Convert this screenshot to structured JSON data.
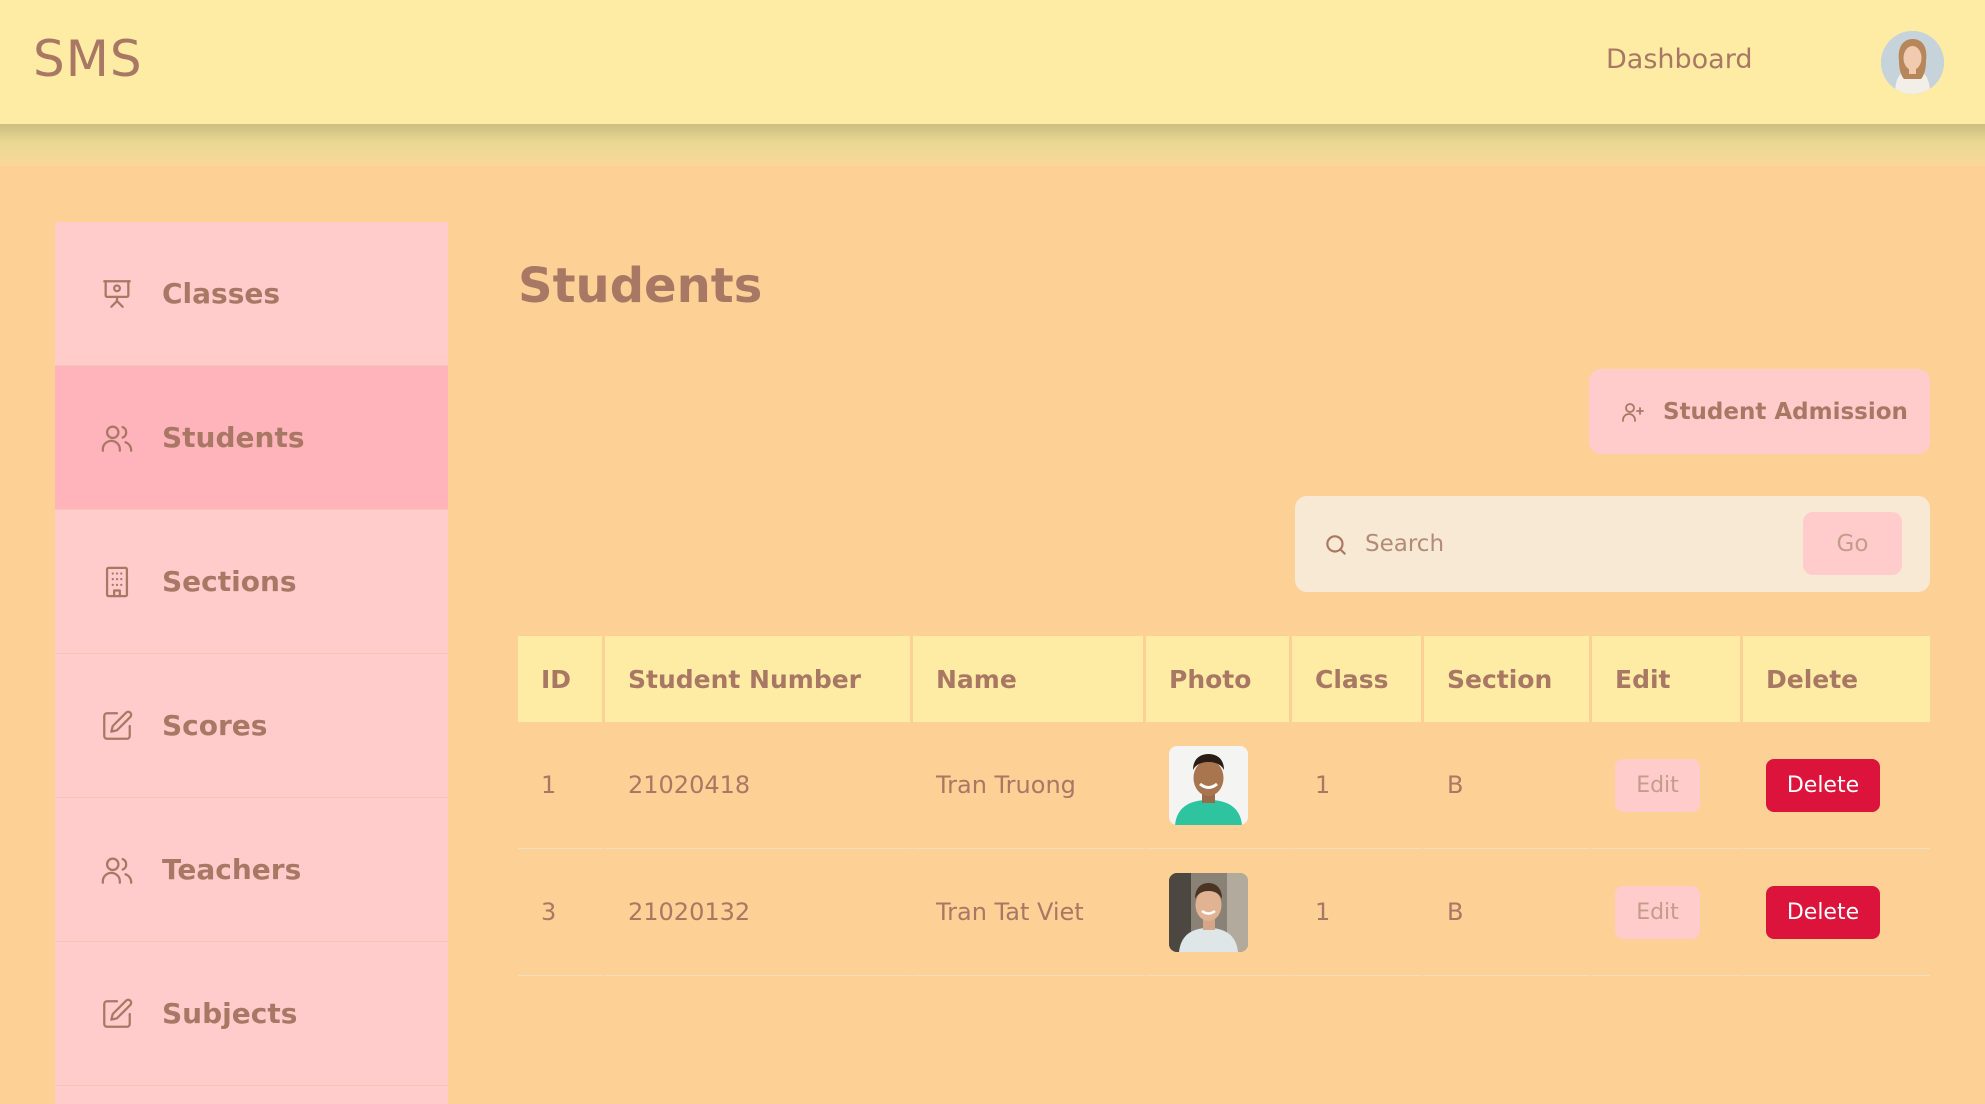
{
  "header": {
    "logo": "SMS",
    "nav_dashboard": "Dashboard"
  },
  "sidebar": {
    "items": [
      {
        "label": "Classes",
        "icon": "presentation-board-icon",
        "active": false
      },
      {
        "label": "Students",
        "icon": "users-icon",
        "active": true
      },
      {
        "label": "Sections",
        "icon": "building-icon",
        "active": false
      },
      {
        "label": "Scores",
        "icon": "edit-icon",
        "active": false
      },
      {
        "label": "Teachers",
        "icon": "users-icon",
        "active": false
      },
      {
        "label": "Subjects",
        "icon": "edit-icon",
        "active": false
      }
    ]
  },
  "main": {
    "title": "Students",
    "admission_button": "Student Admission",
    "search": {
      "placeholder": "Search",
      "value": "",
      "go_label": "Go"
    }
  },
  "table": {
    "headers": [
      "ID",
      "Student Number",
      "Name",
      "Photo",
      "Class",
      "Section",
      "Edit",
      "Delete"
    ],
    "rows": [
      {
        "id": "1",
        "student_number": "21020418",
        "name": "Tran Truong",
        "class": "1",
        "section": "B",
        "edit": "Edit",
        "delete": "Delete"
      },
      {
        "id": "3",
        "student_number": "21020132",
        "name": "Tran Tat Viet",
        "class": "1",
        "section": "B",
        "edit": "Edit",
        "delete": "Delete"
      }
    ]
  },
  "colors": {
    "header_bg": "#feeba4",
    "page_bg": "#fdd095",
    "sidebar_bg": "#ffcbcb",
    "sidebar_active": "#ffb3bb",
    "text": "#a97864",
    "delete": "#dc143c"
  }
}
